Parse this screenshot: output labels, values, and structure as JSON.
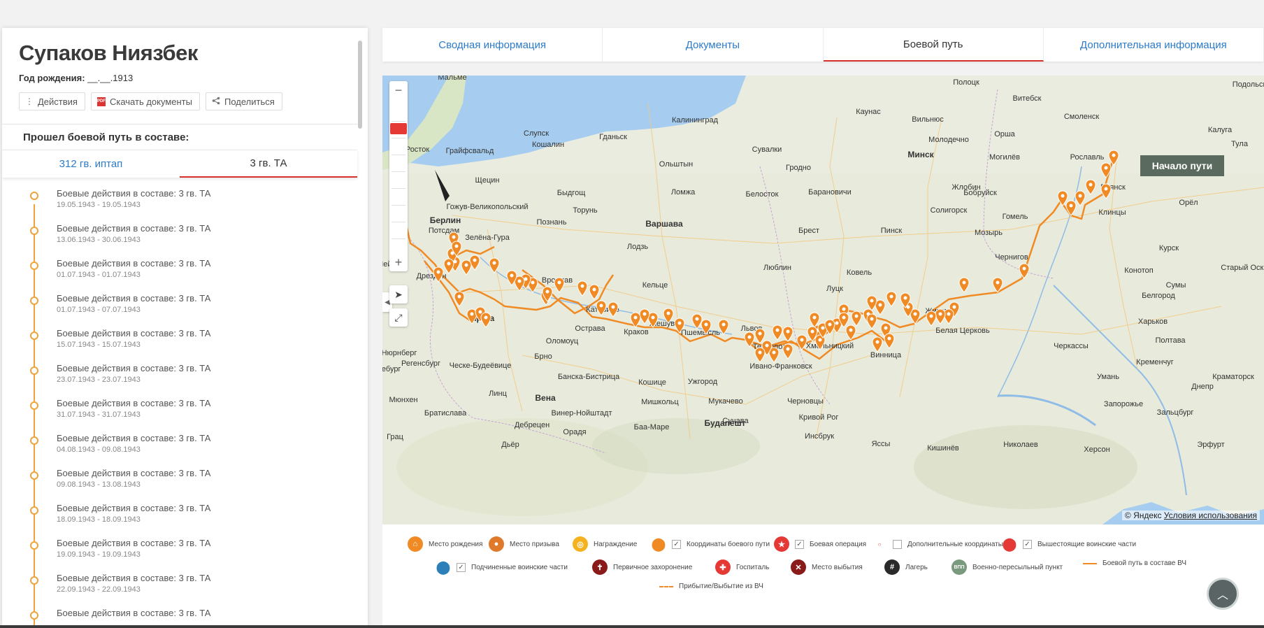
{
  "person": {
    "name": "Супаков Ниязбек",
    "birth_label": "Год рождения:",
    "birth_value": "__.__.1913"
  },
  "actions": {
    "actions_label": "Действия",
    "download_label": "Скачать документы",
    "pdf_badge": "PDF",
    "share_label": "Поделиться"
  },
  "path": {
    "title": "Прошел боевой путь в составе:",
    "unit_tabs": [
      "312 гв. иптап",
      "3 гв. ТА"
    ]
  },
  "timeline": [
    {
      "title": "Боевые действия в составе: 3 гв. ТА",
      "date": "19.05.1943 - 19.05.1943"
    },
    {
      "title": "Боевые действия в составе: 3 гв. ТА",
      "date": "13.06.1943 - 30.06.1943"
    },
    {
      "title": "Боевые действия в составе: 3 гв. ТА",
      "date": "01.07.1943 - 01.07.1943"
    },
    {
      "title": "Боевые действия в составе: 3 гв. ТА",
      "date": "01.07.1943 - 07.07.1943"
    },
    {
      "title": "Боевые действия в составе: 3 гв. ТА",
      "date": "15.07.1943 - 15.07.1943"
    },
    {
      "title": "Боевые действия в составе: 3 гв. ТА",
      "date": "23.07.1943 - 23.07.1943"
    },
    {
      "title": "Боевые действия в составе: 3 гв. ТА",
      "date": "31.07.1943 - 31.07.1943"
    },
    {
      "title": "Боевые действия в составе: 3 гв. ТА",
      "date": "04.08.1943 - 09.08.1943"
    },
    {
      "title": "Боевые действия в составе: 3 гв. ТА",
      "date": "09.08.1943 - 13.08.1943"
    },
    {
      "title": "Боевые действия в составе: 3 гв. ТА",
      "date": "18.09.1943 - 18.09.1943"
    },
    {
      "title": "Боевые действия в составе: 3 гв. ТА",
      "date": "19.09.1943 - 19.09.1943"
    },
    {
      "title": "Боевые действия в составе: 3 гв. ТА",
      "date": "22.09.1943 - 22.09.1943"
    },
    {
      "title": "Боевые действия в составе: 3 гв. ТА",
      "date": ""
    }
  ],
  "tabs": [
    "Сводная информация",
    "Документы",
    "Боевой путь",
    "Дополнительная информация"
  ],
  "active_tab": "Боевой путь",
  "map": {
    "start_label": "Начало пути",
    "copyright": "© Яндекс",
    "terms_link": "Условия использования",
    "cities": [
      "Мальме",
      "Полоцк",
      "Витебск",
      "Подольск",
      "Каунас",
      "Вильнюс",
      "Смоленск",
      "Калининград",
      "Молодечно",
      "Орша",
      "Калуга",
      "Тула",
      "Слупск",
      "Гданьск",
      "Сувалки",
      "Минск",
      "Могилёв",
      "Рославль",
      "Росток",
      "Грайфсвальд",
      "Кошалин",
      "Ольштын",
      "Гродно",
      "Жлобин",
      "Брянск",
      "Щецин",
      "Быдгощ",
      "Ломжа",
      "Белосток",
      "Барановичи",
      "Бобруйск",
      "Торунь",
      "Гожув-Великопольский",
      "Солигорск",
      "Клинцы",
      "Орёл",
      "Берлин",
      "Потсдам",
      "Познань",
      "Зелёна-Гура",
      "Варшава",
      "Брест",
      "Пинск",
      "Гомель",
      "Лодзь",
      "Мозырь",
      "Лейпциг",
      "Дрезден",
      "Вроцлав",
      "Люблин",
      "Ковель",
      "Чернигов",
      "Кельце",
      "Курск",
      "Старый Оскол",
      "Конотоп",
      "Сумы",
      "Катовице",
      "Жешув",
      "Луцк",
      "Житомир",
      "Белгород",
      "Прага",
      "Острава",
      "Краков",
      "Пшемысль",
      "Львов",
      "Белая Церковь",
      "Харьков",
      "Оломоуц",
      "Тернополь",
      "Хмельницкий",
      "Черкассы",
      "Полтава",
      "Винница",
      "Нюрнберг",
      "Регенсбург",
      "Ческе-Будеёвице",
      "Брно",
      "Ивано-Франковск",
      "Кременчуг",
      "Краматорск",
      "Банска-Бистрица",
      "Кошице",
      "Ужгород",
      "Умань",
      "Днепр",
      "Мюнхен",
      "Линц",
      "Вена",
      "Мишкольц",
      "Мукачево",
      "Черновцы",
      "Кривой Рог",
      "Запорожье",
      "Зальцбург",
      "Братислава",
      "Винер-Нойштадт",
      "Дебрецен",
      "Будапешт",
      "Баа-Маре",
      "Сучава",
      "Инсбрук",
      "Грац",
      "Дьёр",
      "Орадя",
      "Ясcы",
      "Кишинёв",
      "Николаев",
      "Херсон",
      "Эрфурт",
      "Магдебург"
    ]
  },
  "legend": {
    "birth": "Место рождения",
    "draft": "Место призыва",
    "award": "Награждение",
    "coords": "Координаты боевого пути",
    "operation": "Боевая операция",
    "extra_coords": "Дополнительные координаты",
    "superior": "Вышестоящие воинские части",
    "subordinate": "Подчиненные воинские части",
    "burial": "Первичное захоронение",
    "hospital": "Госпиталь",
    "loss": "Место выбытия",
    "camp": "Лагерь",
    "transit": "Военно-пересыльный пункт",
    "transit_badge": "ВПП",
    "unit_path": "Боевой путь в составе ВЧ",
    "arrival": "Прибытие/Выбытие из ВЧ"
  },
  "colors": {
    "accent_red": "#d9302c",
    "link_blue": "#2b7bc9",
    "route_orange": "#f08a24"
  }
}
